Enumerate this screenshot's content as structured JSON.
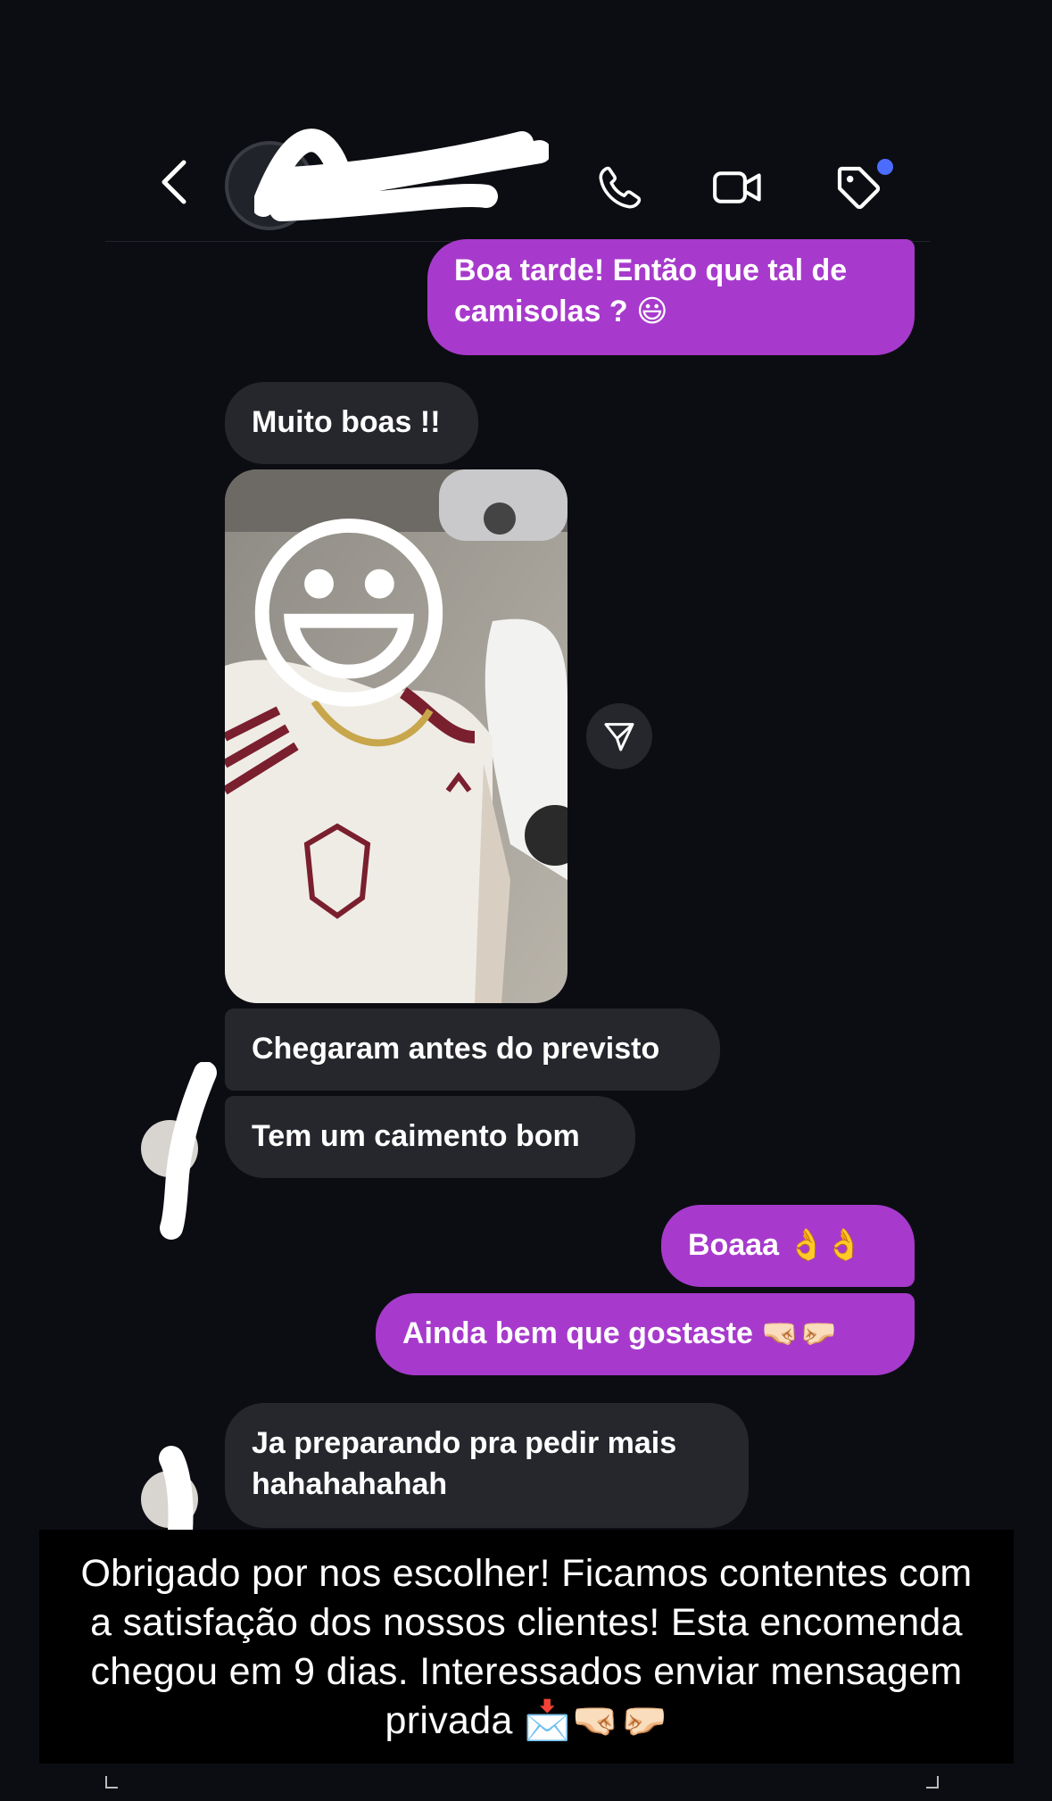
{
  "header": {
    "contact_name": "...",
    "contact_handle": "",
    "back_icon": "chevron-left-icon",
    "call_icon": "phone-icon",
    "video_icon": "video-camera-icon",
    "tag_icon": "tag-icon",
    "accent_dot_color": "#4a6cff"
  },
  "colors": {
    "outgoing_bubble": "#a73acc",
    "incoming_bubble": "#26272d",
    "background": "#0c0d12"
  },
  "messages": [
    {
      "direction": "out",
      "text": "Boa tarde! Então que tal de camisolas ? 😃"
    },
    {
      "direction": "in",
      "text": "Muito boas !!"
    },
    {
      "direction": "in",
      "type": "photo",
      "overlay": "😃"
    },
    {
      "direction": "in",
      "text": "Chegaram antes do previsto"
    },
    {
      "direction": "in",
      "text": "Tem um caimento bom"
    },
    {
      "direction": "out",
      "text": "Boaaa 👌👌"
    },
    {
      "direction": "out",
      "text": "Ainda bem que gostaste 🤜🏻🤛🏻"
    },
    {
      "direction": "in",
      "text": "Ja preparando pra pedir mais hahahahahah"
    }
  ],
  "share_icon": "send-icon",
  "caption": "Obrigado por nos escolher! Ficamos contentes com a satisfação dos nossos clientes! Esta encomenda chegou em 9 dias. Interessados enviar mensagem privada 📩🤜🏻🤛🏻"
}
